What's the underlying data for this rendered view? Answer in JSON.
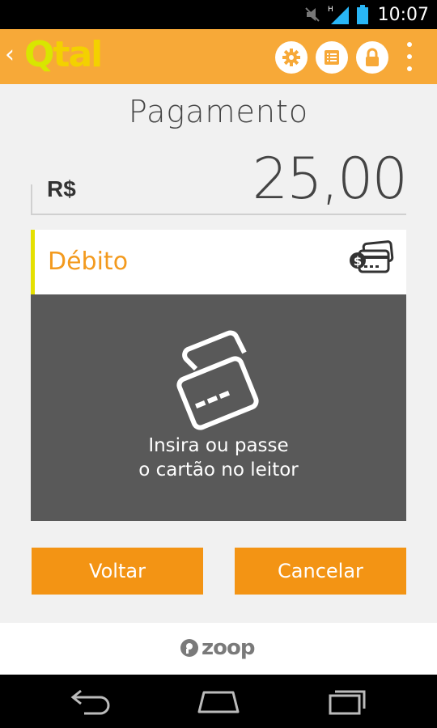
{
  "status_bar": {
    "time": "10:07",
    "network_label": "H",
    "icons": [
      "mute-icon",
      "signal-icon",
      "battery-icon"
    ]
  },
  "app_bar": {
    "back_glyph": "‹",
    "logo_q": "Q",
    "logo_tal": "tal",
    "actions": [
      "settings-icon",
      "receipt-list-icon",
      "lock-icon",
      "overflow-menu-icon"
    ]
  },
  "payment": {
    "title": "Pagamento",
    "currency": "R$",
    "amount": "25,00"
  },
  "card": {
    "type_label": "Débito",
    "instruction_line1": "Insira ou passe",
    "instruction_line2": "o cartão no leitor"
  },
  "buttons": {
    "back_label": "Voltar",
    "cancel_label": "Cancelar"
  },
  "footer": {
    "brand": "zoop"
  },
  "colors": {
    "accent": "#f7a938",
    "button": "#f39414",
    "panel": "#595959",
    "card_type": "#f39a1e",
    "indicator": "#e5e000"
  }
}
